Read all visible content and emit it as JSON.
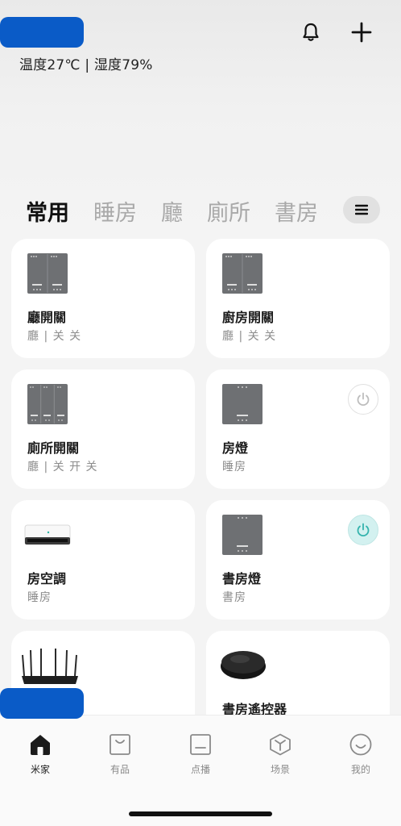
{
  "header": {
    "environment": "温度27℃ | 湿度79%",
    "bell_icon": "bell-icon",
    "add_icon": "plus-icon"
  },
  "tabs": [
    {
      "label": "常用",
      "active": true
    },
    {
      "label": "睡房",
      "active": false
    },
    {
      "label": "廳",
      "active": false
    },
    {
      "label": "廁所",
      "active": false
    },
    {
      "label": "書房",
      "active": false
    }
  ],
  "menu_icon": "menu-icon",
  "devices": [
    {
      "name": "廳開關",
      "sub": "廳 | 关 关",
      "icon": "double-switch-icon"
    },
    {
      "name": "廚房開關",
      "sub": "廳 | 关 关",
      "icon": "double-switch-icon"
    },
    {
      "name": "廁所開關",
      "sub": "廳 | 关 开 关",
      "icon": "triple-switch-icon"
    },
    {
      "name": "房燈",
      "sub": "睡房",
      "icon": "single-switch-icon",
      "power": "off"
    },
    {
      "name": "房空調",
      "sub": "睡房",
      "icon": "air-conditioner-icon"
    },
    {
      "name": "書房燈",
      "sub": "書房",
      "icon": "single-switch-icon",
      "power": "on"
    },
    {
      "name": "",
      "sub": "",
      "icon": "router-icon"
    },
    {
      "name": "書房遙控器",
      "sub": "",
      "icon": "ir-remote-icon"
    }
  ],
  "bottom_nav": [
    {
      "label": "米家",
      "icon": "home-icon",
      "active": true
    },
    {
      "label": "有品",
      "icon": "shopping-bag-icon",
      "active": false
    },
    {
      "label": "点播",
      "icon": "media-icon",
      "active": false
    },
    {
      "label": "场景",
      "icon": "cube-icon",
      "active": false
    },
    {
      "label": "我的",
      "icon": "smiley-icon",
      "active": false
    }
  ],
  "colors": {
    "accent_teal": "#34b3ad",
    "redaction": "#0a5bc7",
    "tab_inactive": "#a9a9a9"
  }
}
